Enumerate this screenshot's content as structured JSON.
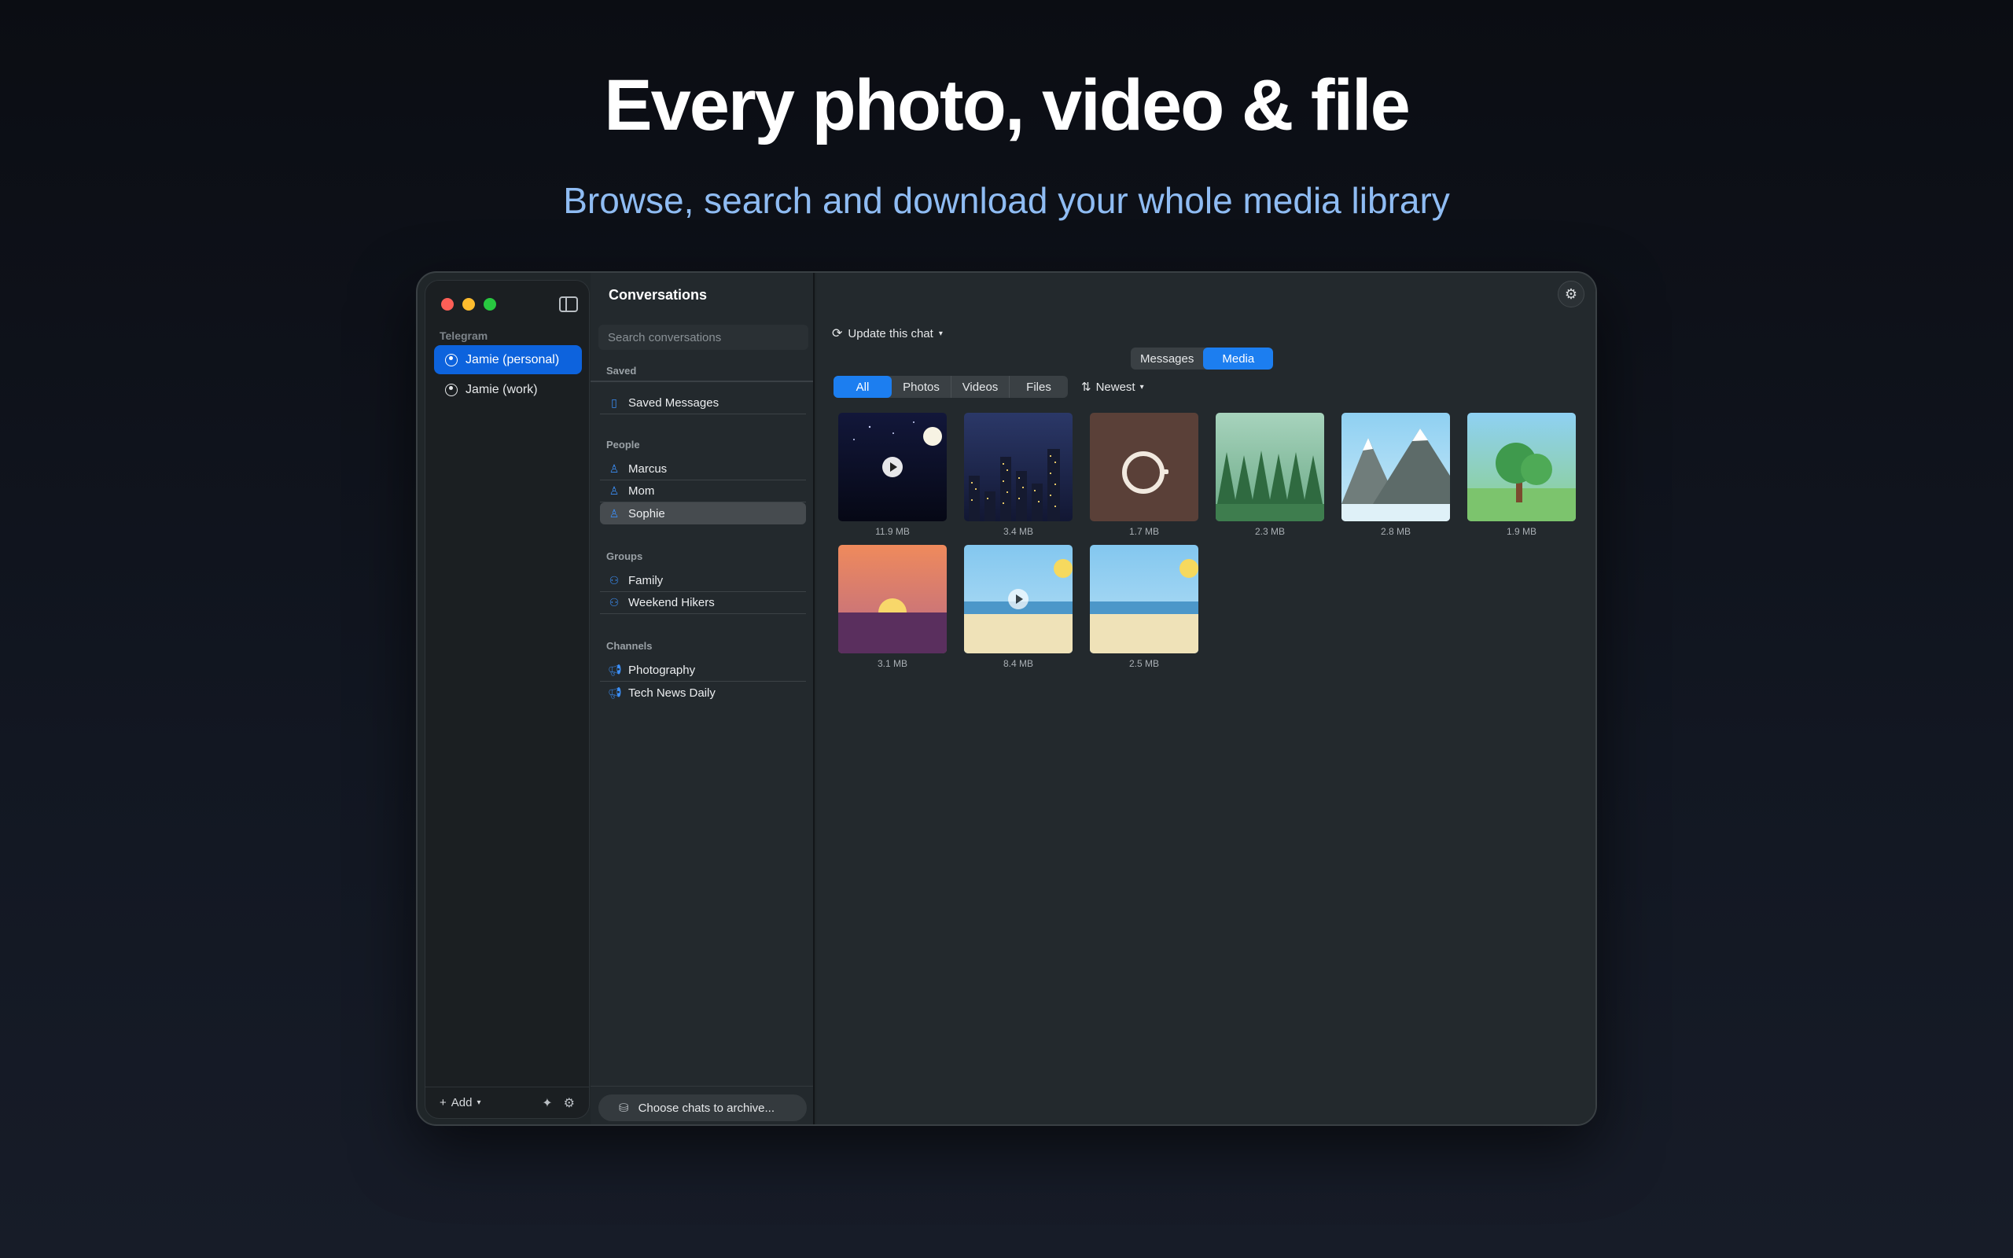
{
  "hero": {
    "title": "Every photo, video & file",
    "subtitle": "Browse, search and download your whole media library"
  },
  "sidebar": {
    "section": "Telegram",
    "accounts": [
      {
        "label": "Jamie (personal)",
        "active": true
      },
      {
        "label": "Jamie (work)",
        "active": false
      }
    ],
    "add_label": "Add"
  },
  "conversations": {
    "title": "Conversations",
    "search_placeholder": "Search conversations",
    "groups": [
      {
        "label": "Saved",
        "items": [
          {
            "label": "Saved Messages",
            "icon": "bookmark-icon"
          }
        ]
      },
      {
        "label": "People",
        "items": [
          {
            "label": "Marcus",
            "icon": "person-icon"
          },
          {
            "label": "Mom",
            "icon": "person-icon"
          },
          {
            "label": "Sophie",
            "icon": "person-icon",
            "active": true
          }
        ]
      },
      {
        "label": "Groups",
        "items": [
          {
            "label": "Family",
            "icon": "people-icon"
          },
          {
            "label": "Weekend Hikers",
            "icon": "people-icon"
          }
        ]
      },
      {
        "label": "Channels",
        "items": [
          {
            "label": "Photography",
            "icon": "megaphone-icon"
          },
          {
            "label": "Tech News Daily",
            "icon": "megaphone-icon"
          }
        ]
      }
    ],
    "archive_label": "Choose chats to archive..."
  },
  "main": {
    "update_label": "Update this chat",
    "view_tabs": [
      {
        "label": "Messages",
        "active": false
      },
      {
        "label": "Media",
        "active": true
      }
    ],
    "filters": [
      {
        "label": "All",
        "active": true
      },
      {
        "label": "Photos",
        "active": false
      },
      {
        "label": "Videos",
        "active": false
      },
      {
        "label": "Files",
        "active": false
      }
    ],
    "sort_label": "Newest",
    "media": [
      {
        "kind": "night-video",
        "size": "11.9 MB",
        "video": true
      },
      {
        "kind": "city-night",
        "size": "3.4 MB",
        "video": false
      },
      {
        "kind": "coffee",
        "size": "1.7 MB",
        "video": false
      },
      {
        "kind": "forest",
        "size": "2.3 MB",
        "video": false
      },
      {
        "kind": "mountains",
        "size": "2.8 MB",
        "video": false
      },
      {
        "kind": "tree",
        "size": "1.9 MB",
        "video": false
      },
      {
        "kind": "sunset",
        "size": "3.1 MB",
        "video": false
      },
      {
        "kind": "beach-video",
        "size": "8.4 MB",
        "video": true
      },
      {
        "kind": "beach",
        "size": "2.5 MB",
        "video": false
      }
    ]
  },
  "colors": {
    "accent": "#1c7ef0",
    "account_active": "#0d63dd",
    "subtitle": "#8fbcf3"
  }
}
